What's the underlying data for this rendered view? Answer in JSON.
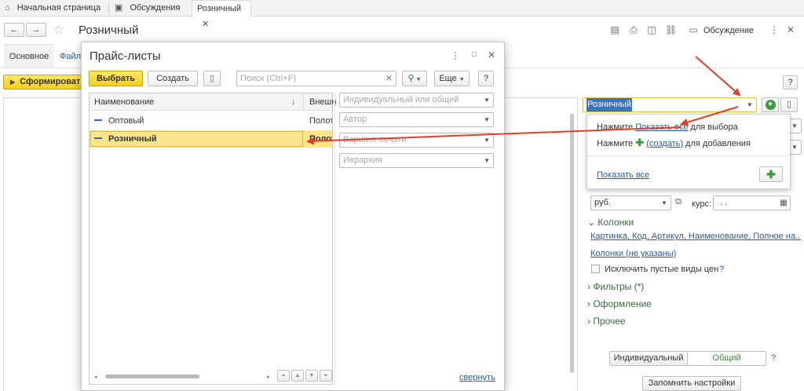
{
  "tabs": {
    "home": "Начальная страница",
    "discussions": "Обсуждения",
    "current": "Розничный"
  },
  "header": {
    "title": "Розничный",
    "discussion_label": "Обсуждение"
  },
  "form_tabs": {
    "main": "Основное",
    "files_partial": "Файл"
  },
  "toolbar": {
    "generate_partial": "Сформироват",
    "help": "?"
  },
  "dialog": {
    "title": "Прайс-листы",
    "select_label": "Выбрать",
    "create_label": "Создать",
    "search_placeholder": "Поиск (Ctrl+F)",
    "more_label": "Еще",
    "help": "?",
    "columns": {
      "name": "Наименование",
      "sort_arrow": "↓",
      "external": "Внешн"
    },
    "rows": [
      {
        "name": "Оптовый",
        "ext": "Полотн"
      },
      {
        "name": "Розничный",
        "ext": "Полот"
      }
    ],
    "filters": [
      "Индивидуальный или общий",
      "Автор",
      "Вариант печати",
      "Иерархия"
    ],
    "collapse_link": "свернуть"
  },
  "right": {
    "price_list_value": "Розничный",
    "popup": {
      "line1_prefix": "Нажмите ",
      "line1_link": "Показать все",
      "line1_suffix": " для выбора",
      "line2_prefix": "Нажмите ",
      "line2_link": "(создать)",
      "line2_suffix": " для добавления",
      "show_all": "Показать все"
    },
    "currency": "руб.",
    "rate_label": "курс:",
    "rate_value": ". .",
    "sections": {
      "columns": "Колонки",
      "filters": "Фильтры (*)",
      "design": "Оформление",
      "other": "Прочее"
    },
    "columns_list": "Картинка, Код, Артикул, Наименование, Полное на...",
    "columns_unspecified": "Колонки (не указаны)",
    "exclude_empty": "Исключить пустые виды цен",
    "q": "?",
    "seg_individual": "Индивидуальный",
    "seg_common": "Общий",
    "save_settings": "Запомнить настройки"
  },
  "colors": {
    "accent_red": "#e0402a",
    "yellow": "#f5d01b",
    "green": "#3a8f3a",
    "link": "#2b5c9d",
    "selected_row": "#fce58a"
  }
}
